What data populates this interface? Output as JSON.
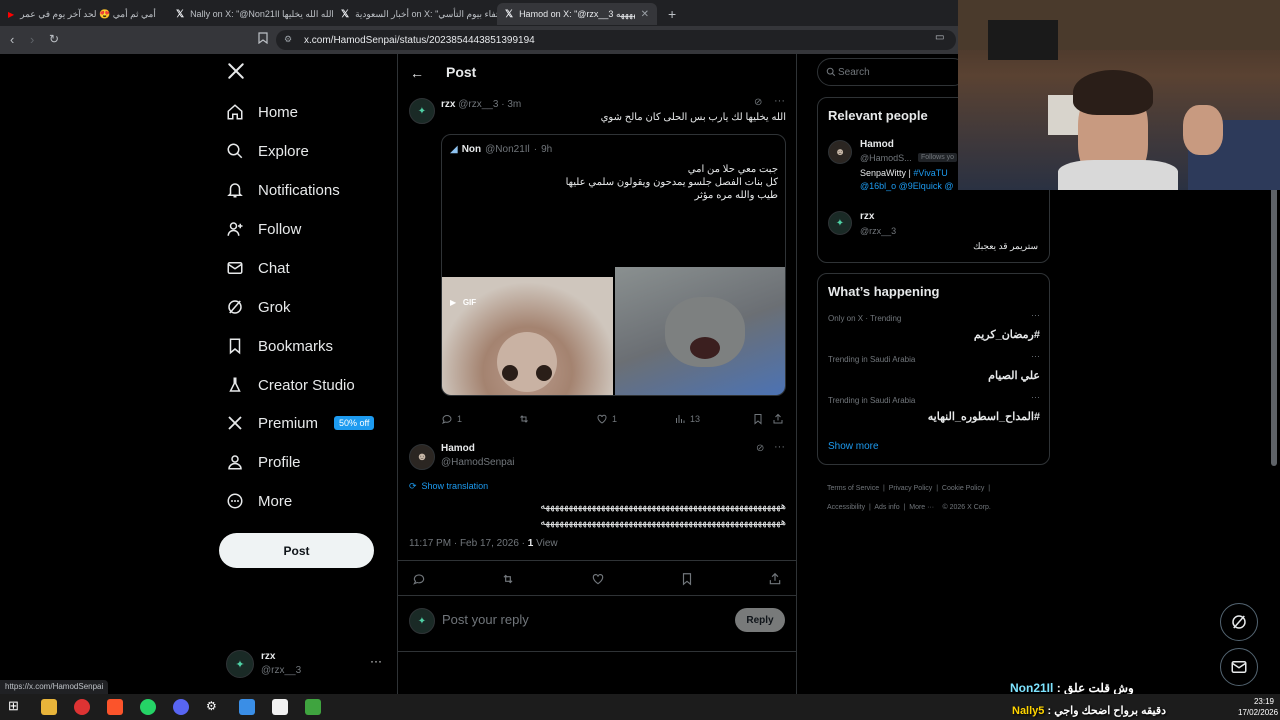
{
  "tabs": [
    {
      "title": "أمي ثم أمي 😍 لحد آخر يوم في عمر"
    },
    {
      "title": "Nally on X: \"@Non21Il الله الله يخليها"
    },
    {
      "title": "أخبار السعودية on X: \"احتفاء بيوم التأسي"
    },
    {
      "title": "Hamod on X: \"@rzx__3 ههههههههه",
      "active": true
    }
  ],
  "url": "x.com/HamodSenpai/status/2023854443851399194",
  "status_url": "https://x.com/HamodSenpai",
  "nav": {
    "items": [
      {
        "label": "Home",
        "icon": "home-icon"
      },
      {
        "label": "Explore",
        "icon": "search-icon"
      },
      {
        "label": "Notifications",
        "icon": "bell-icon"
      },
      {
        "label": "Follow",
        "icon": "add-person-icon"
      },
      {
        "label": "Chat",
        "icon": "mail-icon"
      },
      {
        "label": "Grok",
        "icon": "grok-icon"
      },
      {
        "label": "Bookmarks",
        "icon": "bookmark-icon"
      },
      {
        "label": "Creator Studio",
        "icon": "flask-icon"
      },
      {
        "label": "Premium",
        "icon": "x-icon",
        "badge": "50% off"
      },
      {
        "label": "Profile",
        "icon": "person-icon"
      },
      {
        "label": "More",
        "icon": "more-circle-icon"
      }
    ],
    "post_button": "Post",
    "account": {
      "name": "rzx",
      "handle": "@rzx__3"
    }
  },
  "header": {
    "title": "Post"
  },
  "reply_tweet": {
    "name": "rzx",
    "handle": "@rzx__3",
    "time": "3m",
    "text": "الله يخليها لك يارب بس الحلى كان مالح شوي",
    "quote": {
      "name": "Non",
      "handle": "@Non21Il",
      "time": "9h",
      "lines": [
        "جبت معي حلا من امي",
        "كل بنات الفصل جلسو يمدحون ويقولون سلمي عليها",
        "طيب والله مره مؤثر"
      ],
      "gif_label": "GIF"
    },
    "stats": {
      "replies": "1",
      "likes": "1",
      "views": "13"
    }
  },
  "main_tweet": {
    "name": "Hamod",
    "handle": "@HamodSenpai",
    "show_translation": "Show translation",
    "lines": [
      "ههههههههههههههههههههههههههههههههههههههههههههههههههههه",
      "ههههههههههههههههههههههههههههههههههههههههههههههههههههه"
    ],
    "timestamp": "11:17 PM · Feb 17, 2026 ·",
    "views_count": "1",
    "views_label": "View"
  },
  "reply_box": {
    "placeholder": "Post your reply",
    "button": "Reply"
  },
  "search": {
    "placeholder": "Search"
  },
  "relevant": {
    "title": "Relevant people",
    "people": [
      {
        "name": "Hamod",
        "handle": "@HamodS...",
        "follows": "Follows yo",
        "bio": "SenpaWitty | ",
        "bio_link": "#VivaTU",
        "mentions": "@16bl_o @9Elquick @"
      },
      {
        "name": "rzx",
        "handle": "@rzx__3",
        "bio": "ستريمر قد يعجبك"
      }
    ]
  },
  "happening": {
    "title": "What’s happening",
    "trends": [
      {
        "meta": "Only on X · Trending",
        "name": "#رمضان_كريم"
      },
      {
        "meta": "Trending in Saudi Arabia",
        "name": "علي الصيام"
      },
      {
        "meta": "Trending in Saudi Arabia",
        "name": "#المداح_اسطوره_النهايه"
      }
    ],
    "show_more": "Show more"
  },
  "footer": {
    "links": [
      "Terms of Service",
      "Privacy Policy",
      "Cookie Policy",
      "Accessibility",
      "Ads info",
      "More ···",
      "© 2026 X Corp."
    ]
  },
  "overlay": {
    "chat1_text": "وش قلت علق :",
    "chat1_user": "Non21Il",
    "chat2_text": "دقيقه برواح اضحك واجي :",
    "chat2_user": "Nally5"
  },
  "clock": {
    "time": "23:19",
    "date": "17/02/2026"
  },
  "colors": {
    "accent": "#1d9bf0",
    "background": "#000000",
    "border": "#2f3336",
    "muted": "#71767b"
  }
}
